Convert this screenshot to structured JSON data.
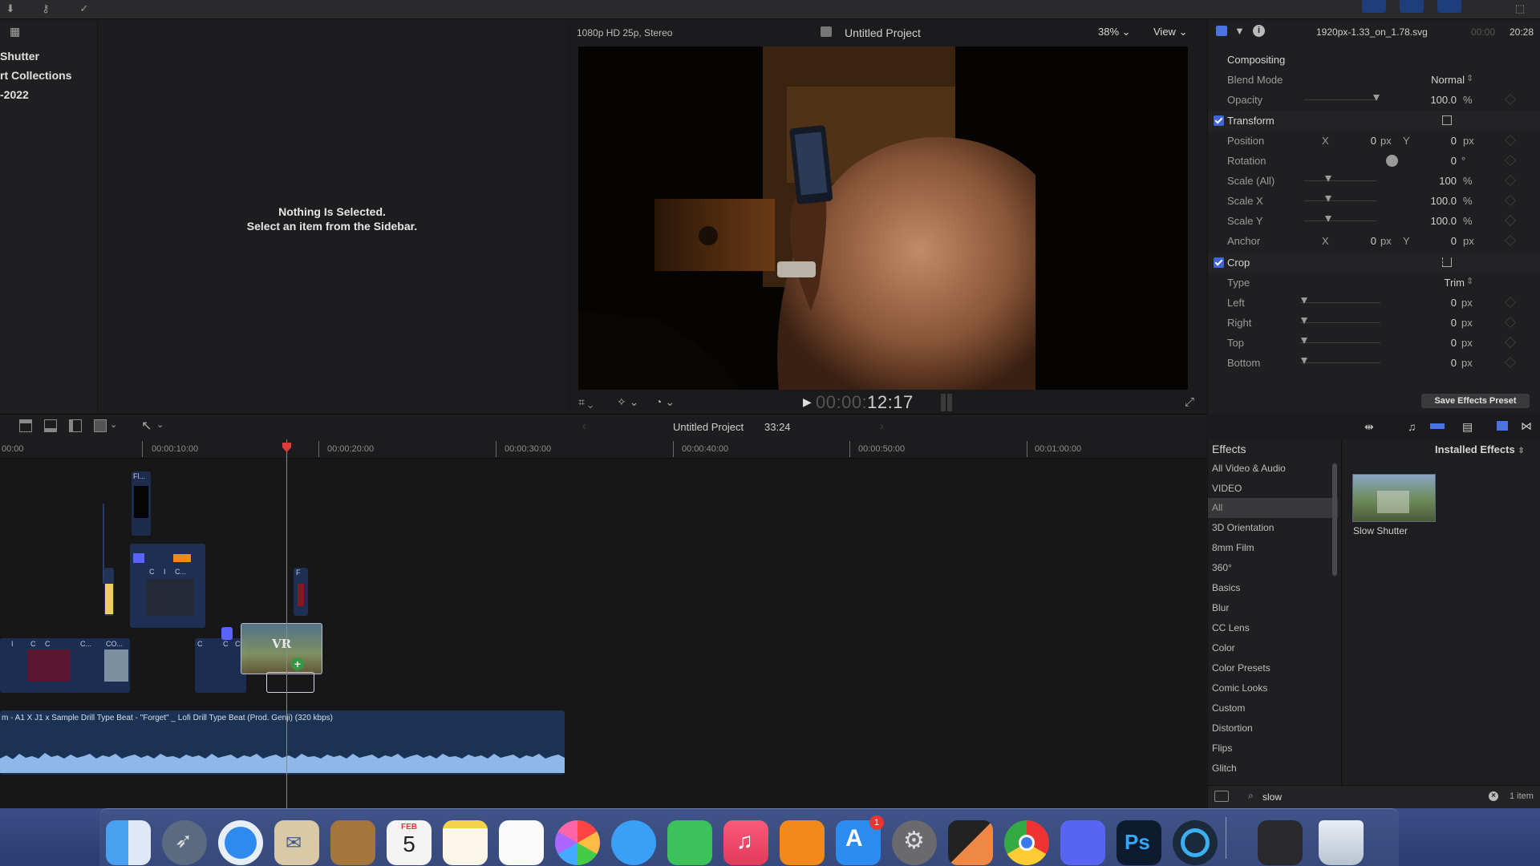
{
  "sidebar": {
    "items": [
      "Shutter",
      "rt Collections",
      "-2022"
    ]
  },
  "browser": {
    "empty_line1": "Nothing Is Selected.",
    "empty_line2": "Select an item from the Sidebar."
  },
  "viewer": {
    "format": "1080p HD 25p, Stereo",
    "project_title": "Untitled Project",
    "zoom": "38%",
    "view_label": "View",
    "timecode_dim": "00:00:",
    "timecode_main": "12:17"
  },
  "inspector": {
    "file_name": "1920px-1.33_on_1.78.svg",
    "duration_dim": "00:00",
    "duration": "20:28",
    "compositing": {
      "title": "Compositing",
      "blend_mode_label": "Blend Mode",
      "blend_mode_value": "Normal",
      "opacity_label": "Opacity",
      "opacity_value": "100.0",
      "opacity_unit": "%",
      "opacity_level": 1.0
    },
    "transform": {
      "title": "Transform",
      "position_label": "Position",
      "position_x_label": "X",
      "position_x": "0",
      "position_y_label": "Y",
      "position_y": "0",
      "px_unit": "px",
      "rotation_label": "Rotation",
      "rotation_value": "0",
      "rotation_unit": "°",
      "scale_all_label": "Scale (All)",
      "scale_all_value": "100",
      "scale_x_label": "Scale X",
      "scale_x_value": "100.0",
      "scale_y_label": "Scale Y",
      "scale_y_value": "100.0",
      "pct_unit": "%",
      "anchor_label": "Anchor",
      "anchor_x": "0",
      "anchor_y": "0"
    },
    "crop": {
      "title": "Crop",
      "type_label": "Type",
      "type_value": "Trim",
      "left_label": "Left",
      "left_value": "0",
      "right_label": "Right",
      "right_value": "0",
      "top_label": "Top",
      "top_value": "0",
      "bottom_label": "Bottom",
      "bottom_value": "0"
    },
    "save_preset": "Save Effects Preset"
  },
  "timeline": {
    "project_name": "Untitled Project",
    "project_duration": "33:24",
    "ruler": [
      "00:00",
      "00:00:10:00",
      "00:00:20:00",
      "00:00:30:00",
      "00:00:40:00",
      "00:00:50:00",
      "00:01:00:00"
    ],
    "audio_clip_label": "m - A1 X J1 x Sample Drill Type Beat - \"Forget\" _ Lofi Drill Type Beat (Prod. Genji) (320 kbps)",
    "clip_labels": [
      "Fl...",
      "C",
      "I",
      "C...",
      "F",
      "I",
      "C",
      "C",
      "C...",
      "CO...",
      "C",
      "C",
      "C",
      "VR"
    ]
  },
  "effects": {
    "title": "Effects",
    "installed_label": "Installed Effects",
    "categories": [
      "All Video & Audio",
      "VIDEO",
      "All",
      "3D Orientation",
      "8mm Film",
      "360°",
      "Basics",
      "Blur",
      "CC Lens",
      "Color",
      "Color Presets",
      "Comic Looks",
      "Custom",
      "Distortion",
      "Flips",
      "Glitch"
    ],
    "selected_category": "All",
    "result_name": "Slow Shutter",
    "search_value": "slow",
    "item_count": "1 item"
  },
  "dock": {
    "calendar_month": "FEB",
    "calendar_day": "5",
    "appstore_badge": "1",
    "ps_label": "Ps"
  },
  "colors": {
    "accent_blue": "#3f66d4",
    "playhead_red": "#e03b3b",
    "clip_blue": "#1c3252"
  }
}
